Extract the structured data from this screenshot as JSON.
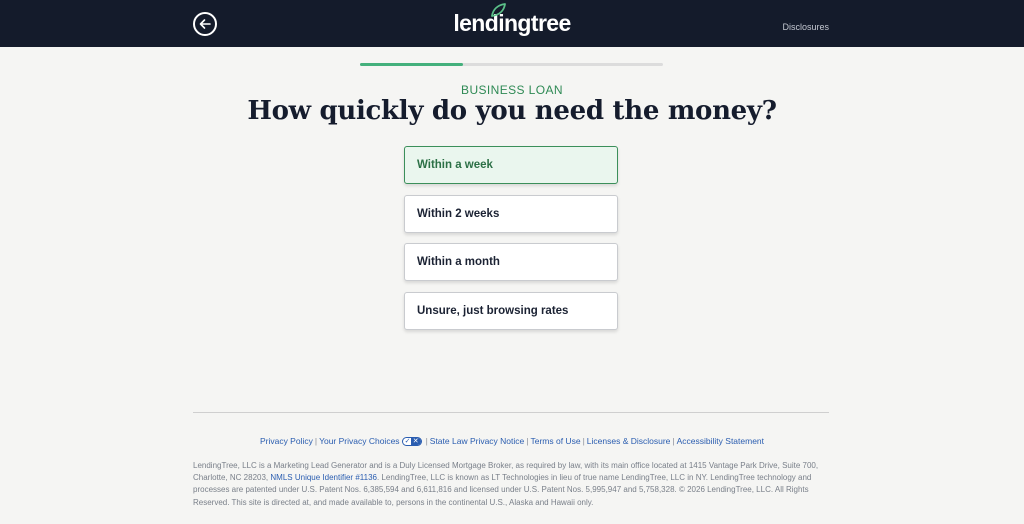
{
  "header": {
    "brand": "lendingtree",
    "back_icon": "arrow-left-icon",
    "leaf_icon": "leaf-icon",
    "disclosures_label": "Disclosures",
    "background": "#141b2b"
  },
  "progress": {
    "value": 0.34,
    "color": "#44b07c"
  },
  "form": {
    "eyebrow": "BUSINESS LOAN",
    "question": "How quickly do you need the money?",
    "options": [
      {
        "label": "Within a week",
        "selected": true
      },
      {
        "label": "Within 2 weeks",
        "selected": false
      },
      {
        "label": "Within a month",
        "selected": false
      },
      {
        "label": "Unsure, just browsing rates",
        "selected": false
      }
    ],
    "selected_color": "#3b8f5a"
  },
  "footer": {
    "links": {
      "privacy_policy": "Privacy Policy",
      "privacy_choices": "Your Privacy Choices",
      "state_law": "State Law Privacy Notice",
      "terms": "Terms of Use",
      "licenses": "Licenses & Disclosure",
      "accessibility": "Accessibility Statement"
    },
    "separator": "|",
    "privacy_choices_icon": "privacy-options-toggle-icon",
    "legal_before": "LendingTree, LLC is a Marketing Lead Generator and is a Duly Licensed Mortgage Broker, as required by law, with its main office located at 1415 Vantage Park Drive, Suite 700, Charlotte, NC 28203,",
    "nmls_link": "NMLS Unique Identifier #1136",
    "legal_after": ". LendingTree, LLC is known as LT Technologies in lieu of true name LendingTree, LLC in NY. LendingTree technology and processes are patented under U.S. Patent Nos. 6,385,594 and 6,611,816 and licensed under U.S. Patent Nos. 5,995,947 and 5,758,328. © 2026 LendingTree, LLC. All Rights Reserved. This site is directed at, and made available to, persons in the continental U.S., Alaska and Hawaii only.",
    "link_color": "#2a5db0"
  }
}
